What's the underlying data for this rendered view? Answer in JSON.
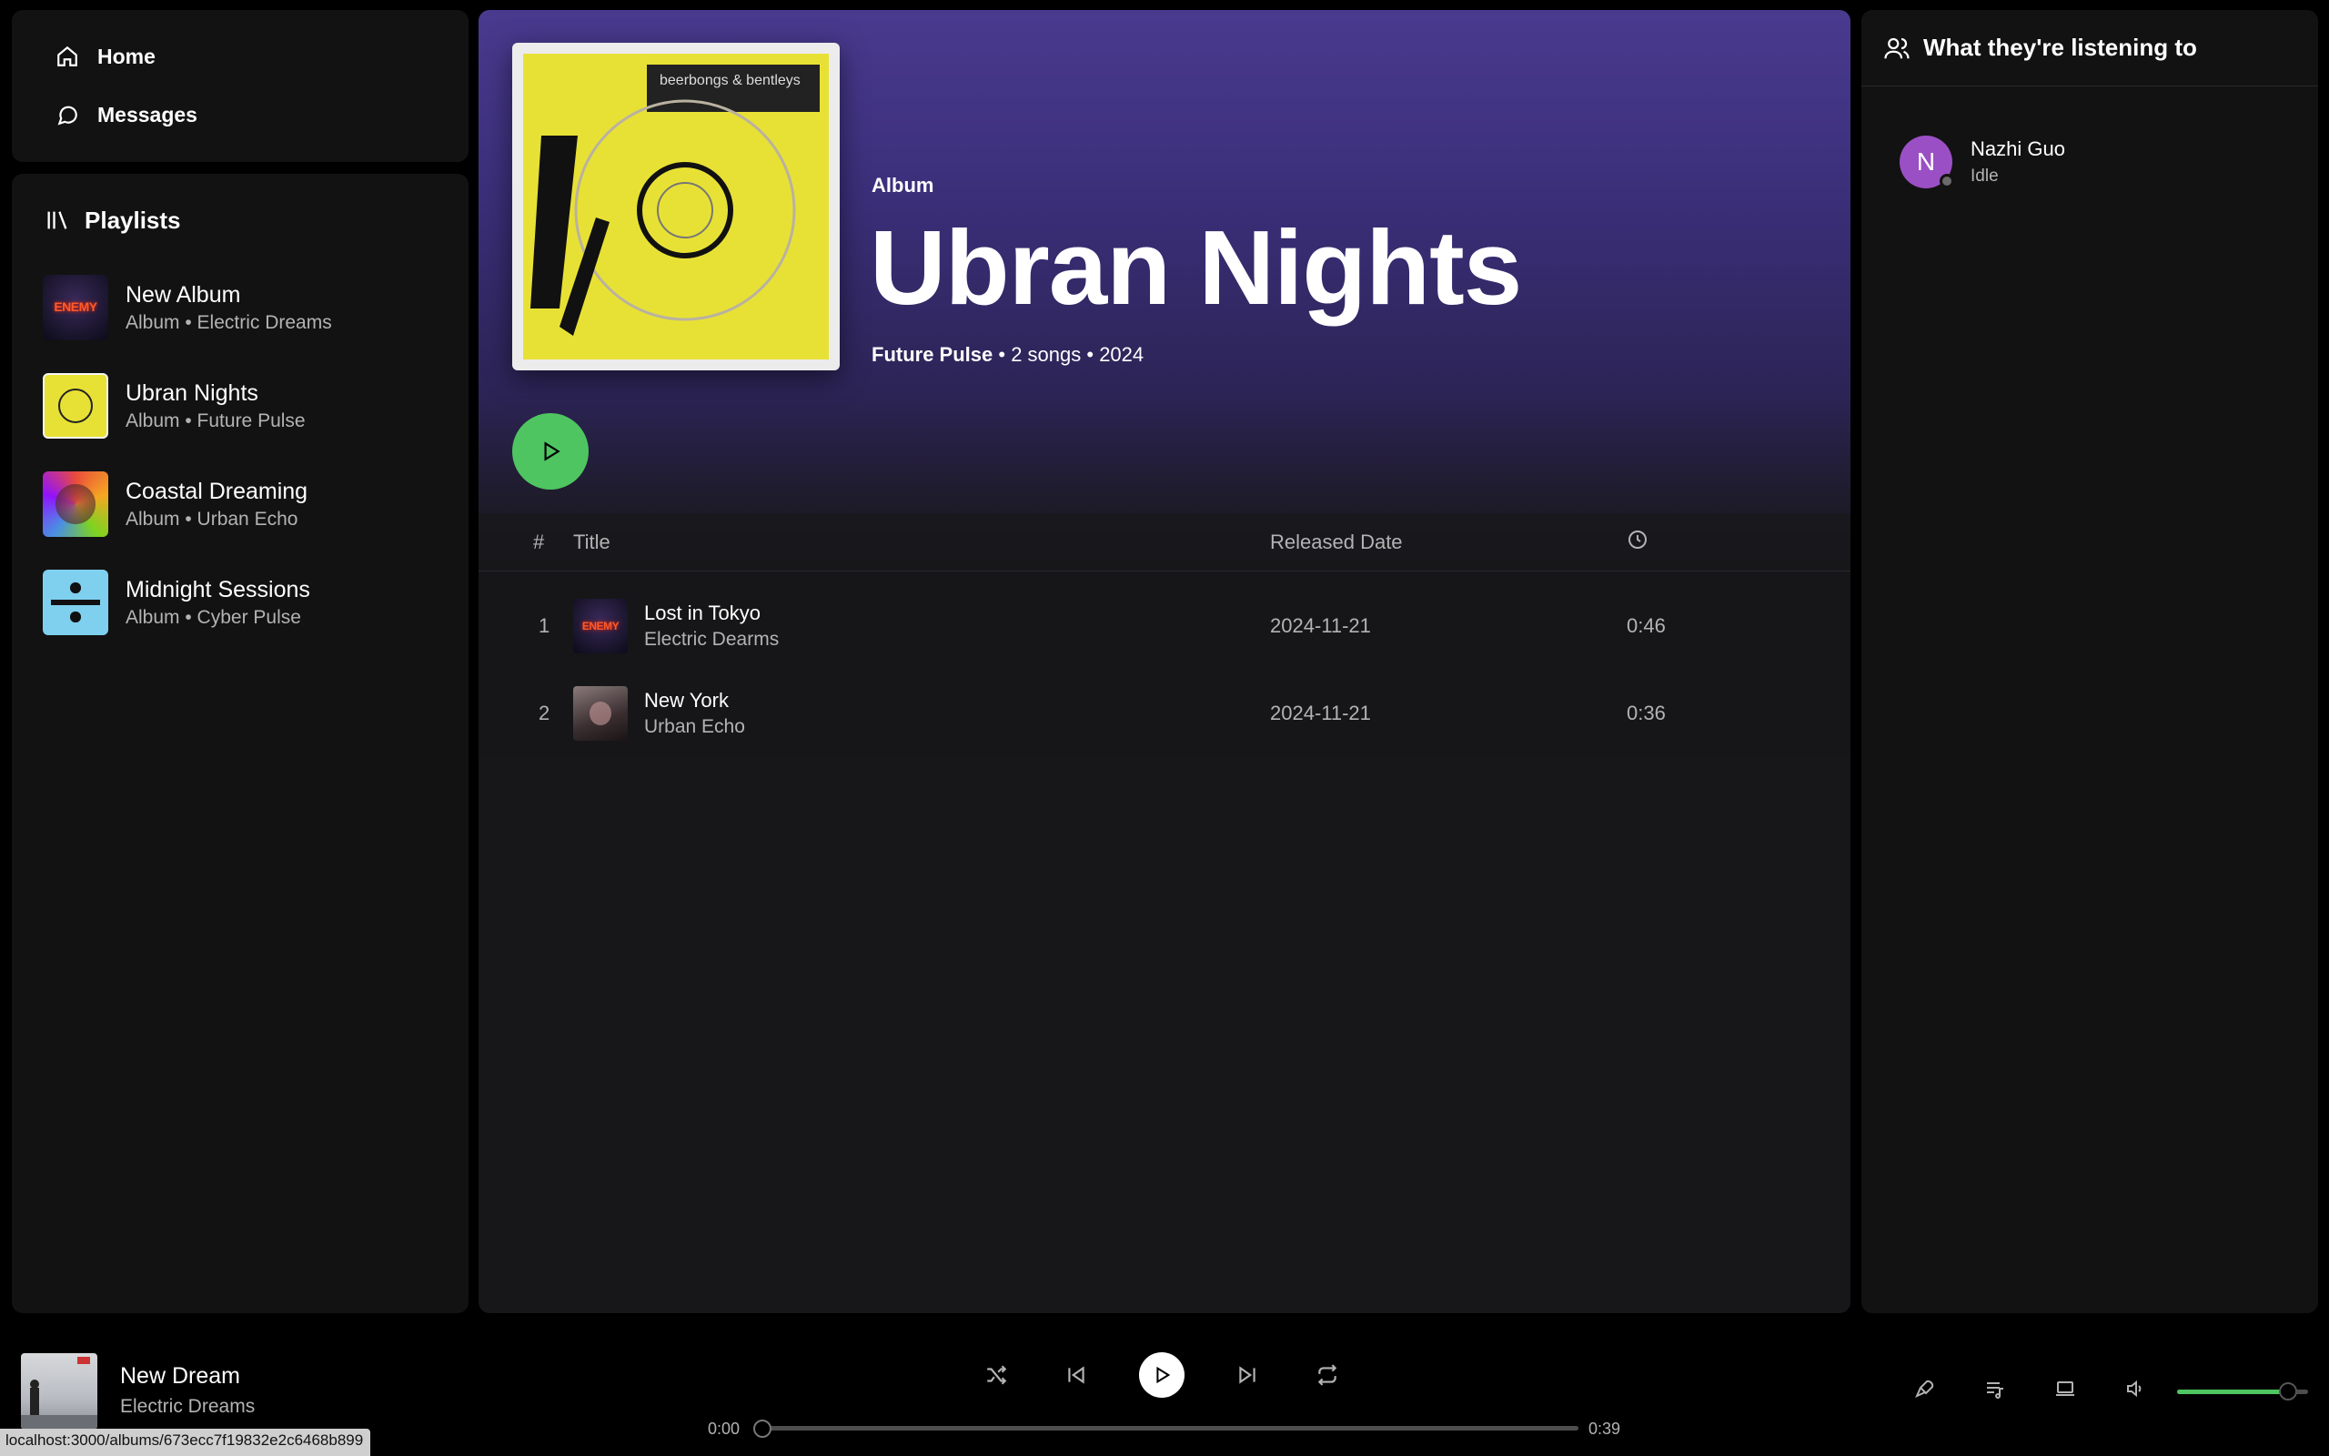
{
  "nav": {
    "home_label": "Home",
    "messages_label": "Messages"
  },
  "library": {
    "header": "Playlists",
    "items": [
      {
        "title": "New Album",
        "subtitle": "Album • Electric Dreams",
        "art": "enemy",
        "art_text": "ENEMY"
      },
      {
        "title": "Ubran Nights",
        "subtitle": "Album • Future Pulse",
        "art": "yellow"
      },
      {
        "title": "Coastal Dreaming",
        "subtitle": "Album • Urban Echo",
        "art": "coastal"
      },
      {
        "title": "Midnight Sessions",
        "subtitle": "Album • Cyber Pulse",
        "art": "divide"
      }
    ]
  },
  "album": {
    "type": "Album",
    "title": "Ubran Nights",
    "artist": "Future Pulse",
    "song_count": "• 2 songs",
    "year": "• 2024",
    "cover_art_text": "beerbongs & bentleys"
  },
  "table": {
    "headers": {
      "num": "#",
      "title": "Title",
      "date": "Released Date",
      "duration_icon": "clock-icon"
    },
    "rows": [
      {
        "num": "1",
        "title": "Lost in Tokyo",
        "artist": "Electric Dearms",
        "date": "2024-11-21",
        "duration": "0:46",
        "art": "enemy",
        "art_text": "ENEMY"
      },
      {
        "num": "2",
        "title": "New York",
        "artist": "Urban Echo",
        "date": "2024-11-21",
        "duration": "0:36",
        "art": "ny"
      }
    ]
  },
  "friends": {
    "header": "What they're listening to",
    "items": [
      {
        "initial": "N",
        "name": "Nazhi Guo",
        "status": "Idle"
      }
    ]
  },
  "player": {
    "now_playing_title": "New Dream",
    "now_playing_artist": "Electric Dreams",
    "time_current": "0:00",
    "time_total": "0:39",
    "progress_fraction": 0.0,
    "volume_fraction": 0.85
  },
  "status_url": "localhost:3000/albums/673ecc7f19832e2c6468b899",
  "colors": {
    "accent": "#4fc561",
    "avatar": "#9b4fc4",
    "header_gradient_top": "#4a3a8f",
    "background": "#121212"
  }
}
